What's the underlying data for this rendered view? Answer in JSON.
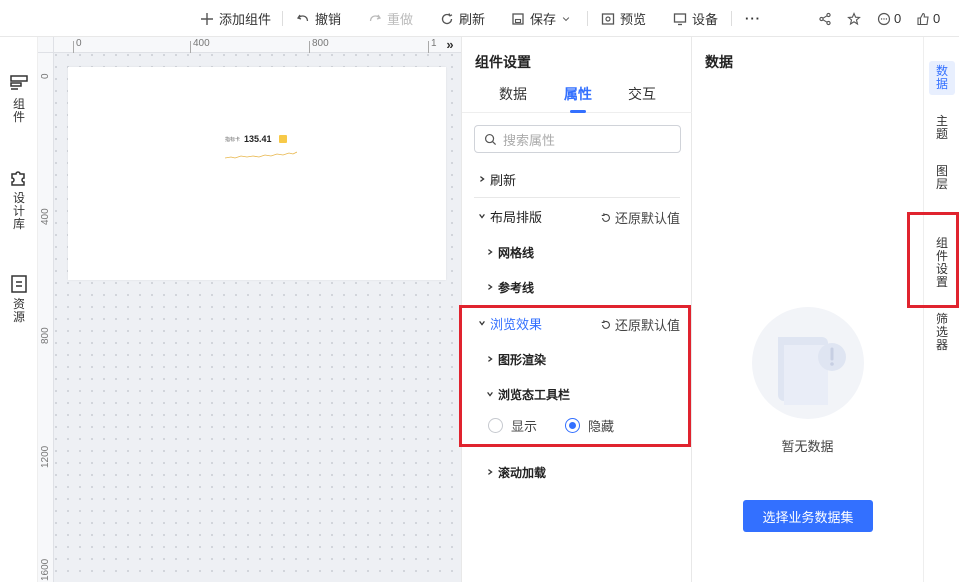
{
  "toolbar": {
    "add_component": "添加组件",
    "undo": "撤销",
    "redo": "重做",
    "refresh": "刷新",
    "save": "保存",
    "preview": "预览",
    "device": "设备",
    "more": "···",
    "comment_count": "0",
    "like_count": "0"
  },
  "left_rail": {
    "components": [
      "组",
      "件"
    ],
    "design_lib": [
      "设",
      "计",
      "库"
    ],
    "resources": [
      "资",
      "源"
    ]
  },
  "canvas": {
    "ruler_x": [
      "0",
      "400",
      "800",
      "1"
    ],
    "ruler_y": [
      "0",
      "400",
      "800",
      "1200",
      "1600"
    ],
    "collapse": "»",
    "widget_label": "指标卡",
    "widget_value": "135.41"
  },
  "settings": {
    "title": "组件设置",
    "tabs": [
      "数据",
      "属性",
      "交互"
    ],
    "active_tab": "属性",
    "search_placeholder": "搜索属性",
    "sections": {
      "refresh": "刷新",
      "layout": "布局排版",
      "gridlines": "网格线",
      "refline": "参考线",
      "browse_effect": "浏览效果",
      "render": "图形渲染",
      "browse_toolbar": "浏览态工具栏",
      "scroll_load": "滚动加载"
    },
    "reset_label": "还原默认值",
    "radio": {
      "show": "显示",
      "hide": "隐藏",
      "selected": "隐藏"
    }
  },
  "data_panel": {
    "title": "数据",
    "empty_text": "暂无数据",
    "select_button": "选择业务数据集"
  },
  "right_rail": {
    "data": [
      "数",
      "据"
    ],
    "theme": [
      "主",
      "题"
    ],
    "layers": [
      "图",
      "层"
    ],
    "component_settings": [
      "组",
      "件",
      "设",
      "置"
    ],
    "filter": [
      "筛",
      "选",
      "器"
    ]
  },
  "colors": {
    "accent": "#3370ff",
    "highlight": "#e0232e",
    "canvas_bg": "#eef0f4",
    "widget_yellow": "#f7c948"
  }
}
